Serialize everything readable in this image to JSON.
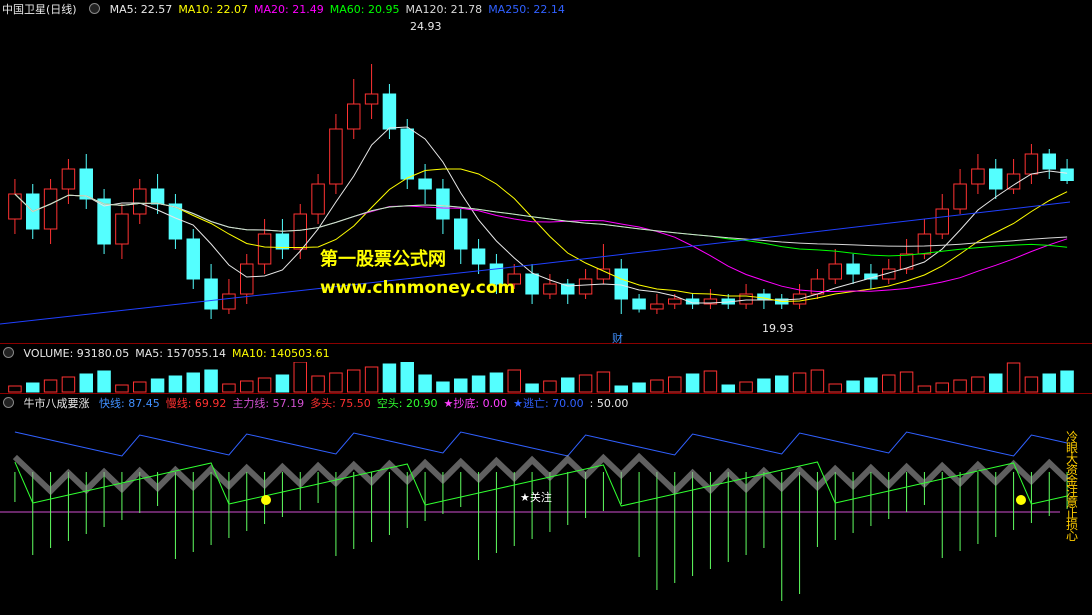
{
  "header": {
    "stock": "中国卫星(日线)",
    "ma": [
      {
        "label": "MA5: 22.57",
        "color": "#e8e8e8"
      },
      {
        "label": "MA10: 22.07",
        "color": "#ffff00"
      },
      {
        "label": "MA20: 21.49",
        "color": "#ff00ff"
      },
      {
        "label": "MA60: 20.95",
        "color": "#00ff00"
      },
      {
        "label": "MA120: 21.78",
        "color": "#d8d8d8"
      },
      {
        "label": "MA250: 22.14",
        "color": "#3060ff"
      }
    ]
  },
  "price_annotations": {
    "high": "24.93",
    "low": "19.93",
    "fin_marker": "财"
  },
  "volume_header": [
    {
      "label": "VOLUME: 93180.05",
      "color": "#e8e8e8"
    },
    {
      "label": "MA5: 157055.14",
      "color": "#e8e8e8"
    },
    {
      "label": "MA10: 140503.61",
      "color": "#ffff00"
    }
  ],
  "indicator_header": {
    "name": "牛市八成要涨",
    "items": [
      {
        "label": "快线: 87.45",
        "color": "#4090ff"
      },
      {
        "label": "慢线: 69.92",
        "color": "#ff3030"
      },
      {
        "label": "主力线: 57.19",
        "color": "#d050d0"
      },
      {
        "label": "多头: 75.50",
        "color": "#ff3030"
      },
      {
        "label": "空头: 20.90",
        "color": "#30ff30"
      },
      {
        "label": "★抄底: 0.00",
        "color": "#ff40ff"
      },
      {
        "label": "★逃亡: 70.00",
        "color": "#3060ff"
      },
      {
        "label": ": 50.00",
        "color": "#e8e8e8"
      }
    ]
  },
  "indicator_annotations": {
    "focus": "★关注",
    "side_text": "冷眼大资金注意止损心"
  },
  "watermark": {
    "line1": "第一股票公式网",
    "line2": "www.chnmoney.com"
  },
  "chart_data": {
    "type": "candlestick",
    "series_count": 60,
    "price_range": [
      19.5,
      25.5
    ],
    "candles": [
      [
        21.8,
        22.3,
        22.6,
        21.5
      ],
      [
        22.3,
        21.6,
        22.5,
        21.4
      ],
      [
        21.6,
        22.4,
        22.6,
        21.3
      ],
      [
        22.4,
        22.8,
        23.0,
        22.1
      ],
      [
        22.8,
        22.2,
        23.1,
        22.0
      ],
      [
        22.2,
        21.3,
        22.4,
        21.1
      ],
      [
        21.3,
        21.9,
        22.1,
        21.0
      ],
      [
        21.9,
        22.4,
        22.6,
        21.7
      ],
      [
        22.4,
        22.1,
        22.7,
        21.9
      ],
      [
        22.1,
        21.4,
        22.3,
        21.2
      ],
      [
        21.4,
        20.6,
        21.6,
        20.4
      ],
      [
        20.6,
        20.0,
        20.9,
        19.8
      ],
      [
        20.0,
        20.3,
        20.6,
        19.9
      ],
      [
        20.3,
        20.9,
        21.1,
        20.1
      ],
      [
        20.9,
        21.5,
        21.8,
        20.7
      ],
      [
        21.5,
        21.2,
        21.8,
        21.0
      ],
      [
        21.2,
        21.9,
        22.1,
        21.0
      ],
      [
        21.9,
        22.5,
        22.7,
        21.7
      ],
      [
        22.5,
        23.6,
        23.9,
        22.3
      ],
      [
        23.6,
        24.1,
        24.6,
        23.4
      ],
      [
        24.1,
        24.3,
        24.9,
        23.8
      ],
      [
        24.3,
        23.6,
        24.5,
        23.4
      ],
      [
        23.6,
        22.6,
        23.8,
        22.4
      ],
      [
        22.6,
        22.4,
        22.9,
        22.1
      ],
      [
        22.4,
        21.8,
        22.6,
        21.5
      ],
      [
        21.8,
        21.2,
        22.0,
        20.9
      ],
      [
        21.2,
        20.9,
        21.4,
        20.7
      ],
      [
        20.9,
        20.5,
        21.1,
        20.3
      ],
      [
        20.5,
        20.7,
        20.9,
        20.4
      ],
      [
        20.7,
        20.3,
        20.9,
        20.1
      ],
      [
        20.3,
        20.5,
        20.7,
        20.2
      ],
      [
        20.5,
        20.3,
        20.6,
        20.1
      ],
      [
        20.3,
        20.6,
        20.8,
        20.2
      ],
      [
        20.6,
        20.8,
        21.3,
        20.5
      ],
      [
        20.8,
        20.2,
        21.0,
        19.9
      ],
      [
        20.2,
        20.0,
        20.3,
        19.93
      ],
      [
        20.0,
        20.1,
        20.3,
        19.9
      ],
      [
        20.1,
        20.2,
        20.3,
        20.0
      ],
      [
        20.2,
        20.1,
        20.3,
        20.0
      ],
      [
        20.1,
        20.2,
        20.4,
        20.0
      ],
      [
        20.2,
        20.1,
        20.3,
        20.0
      ],
      [
        20.1,
        20.3,
        20.5,
        20.0
      ],
      [
        20.3,
        20.2,
        20.4,
        20.0
      ],
      [
        20.2,
        20.1,
        20.3,
        20.0
      ],
      [
        20.1,
        20.3,
        20.5,
        20.0
      ],
      [
        20.3,
        20.6,
        20.8,
        20.2
      ],
      [
        20.6,
        20.9,
        21.2,
        20.5
      ],
      [
        20.9,
        20.7,
        21.1,
        20.5
      ],
      [
        20.7,
        20.6,
        20.9,
        20.4
      ],
      [
        20.6,
        20.8,
        21.0,
        20.5
      ],
      [
        20.8,
        21.1,
        21.4,
        20.7
      ],
      [
        21.1,
        21.5,
        21.8,
        21.0
      ],
      [
        21.5,
        22.0,
        22.3,
        21.4
      ],
      [
        22.0,
        22.5,
        22.8,
        21.9
      ],
      [
        22.5,
        22.8,
        23.1,
        22.3
      ],
      [
        22.8,
        22.4,
        23.0,
        22.2
      ],
      [
        22.4,
        22.7,
        23.0,
        22.3
      ],
      [
        22.7,
        23.1,
        23.3,
        22.5
      ],
      [
        23.1,
        22.8,
        23.2,
        22.6
      ],
      [
        22.8,
        22.57,
        23.0,
        22.5
      ]
    ]
  }
}
